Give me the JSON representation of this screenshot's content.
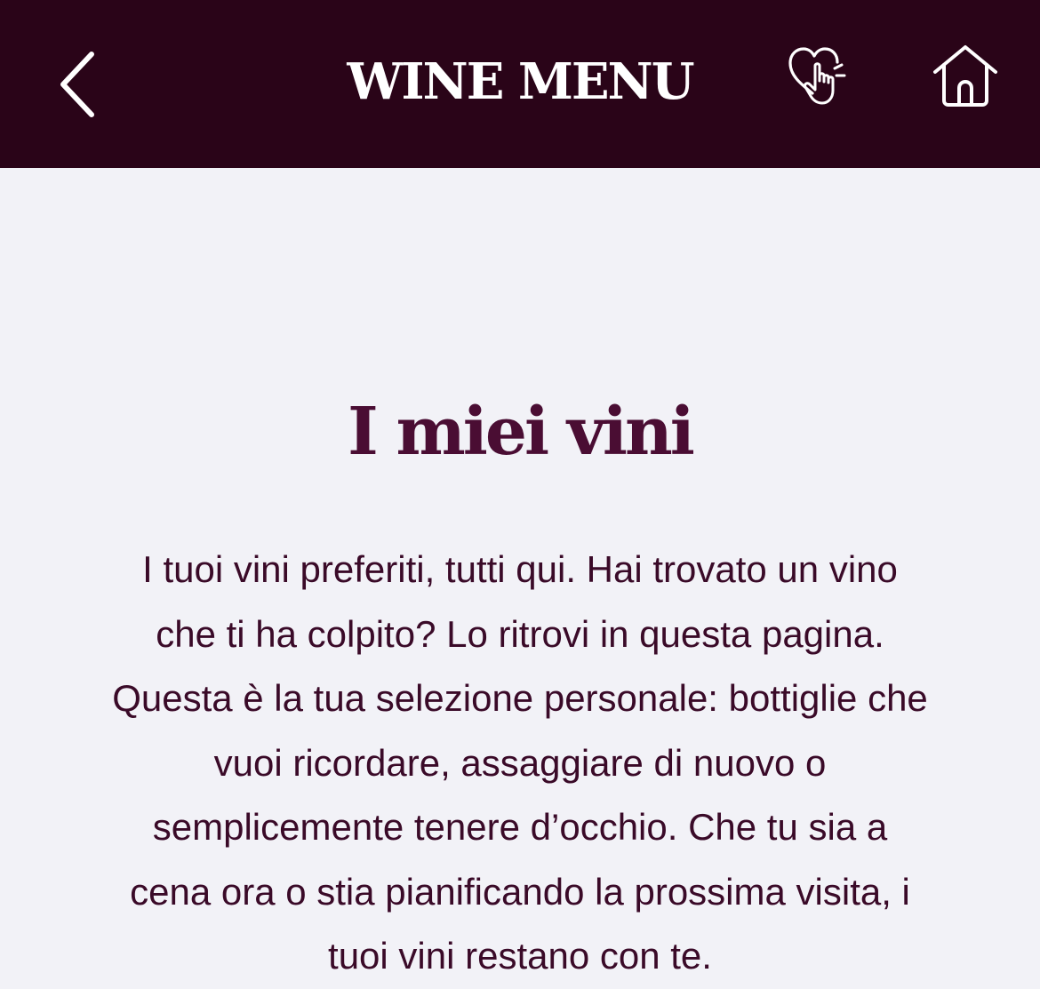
{
  "header": {
    "title": "WINE MENU",
    "back_icon": "chevron-left-icon",
    "favorites_icon": "heart-hand-icon",
    "home_icon": "home-icon"
  },
  "main": {
    "title": "I miei vini",
    "description": "I tuoi vini preferiti, tutti qui.  Hai trovato un vino\nche ti ha colpito? Lo ritrovi in questa pagina.\nQuesta è la tua selezione personale: bottiglie che\nvuoi ricordare, assaggiare di nuovo o\nsemplicemente tenere d’occhio. Che tu sia a\ncena ora o stia pianificando la prossima visita, i\ntuoi vini restano con te."
  },
  "colors": {
    "header_background": "#2a0418",
    "page_background": "#f2f2f7",
    "title_color": "#4a0d33",
    "text_color": "#3a0a28"
  }
}
